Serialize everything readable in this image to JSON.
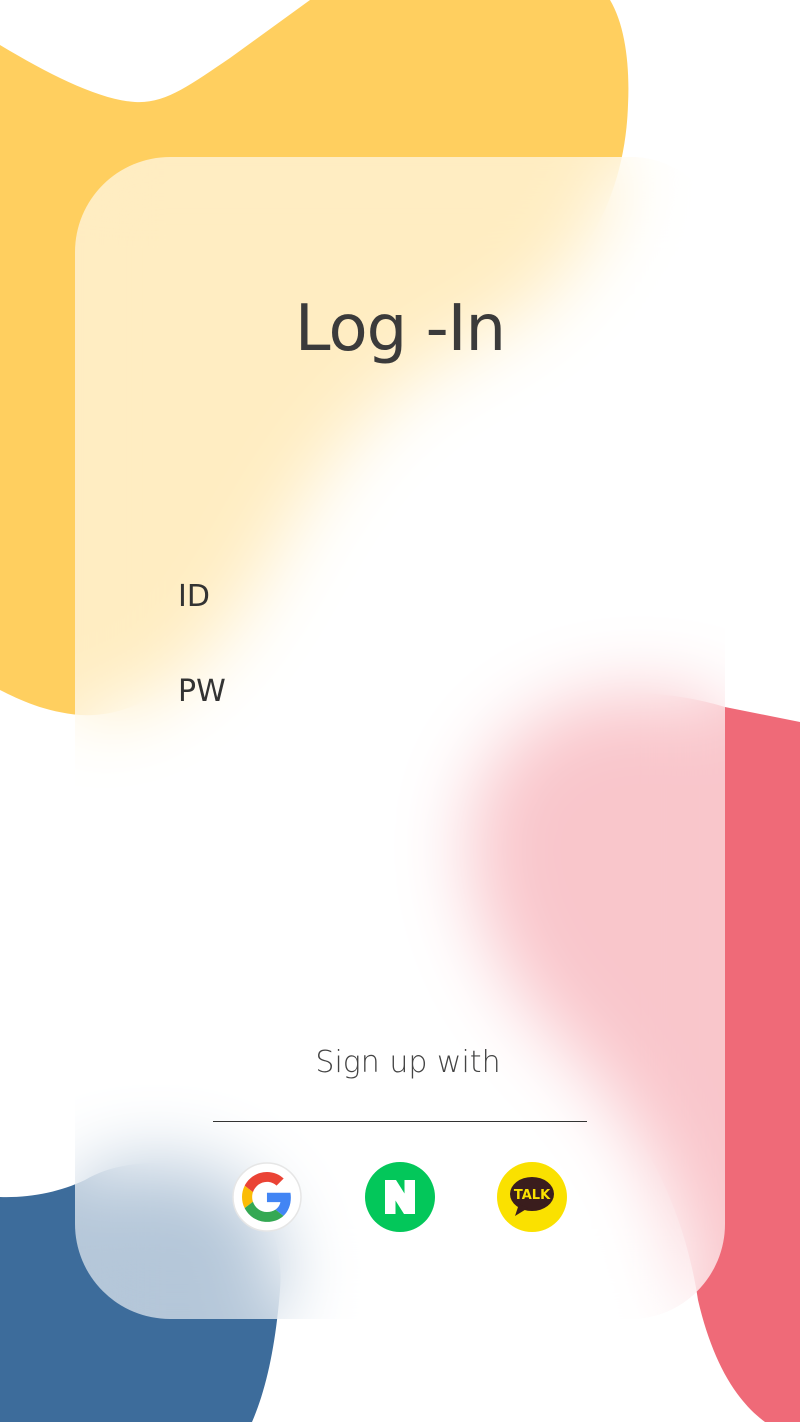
{
  "login": {
    "title": "Log -In",
    "id_label": "ID",
    "pw_label": "PW",
    "id_value": "",
    "pw_value": ""
  },
  "signup": {
    "label": "Sign up with",
    "providers": [
      {
        "name": "Google",
        "icon": "google-icon"
      },
      {
        "name": "Naver",
        "icon": "naver-icon"
      },
      {
        "name": "KakaoTalk",
        "icon": "kakaotalk-icon",
        "badge_text": "TALK"
      }
    ]
  },
  "colors": {
    "yellow_blob": "#FFCF5F",
    "pink_blob": "#EF6A78",
    "blue_blob": "#3D6C9B",
    "naver_green": "#03C75A",
    "kakao_yellow": "#FAE100",
    "text": "#3B3B3B"
  }
}
